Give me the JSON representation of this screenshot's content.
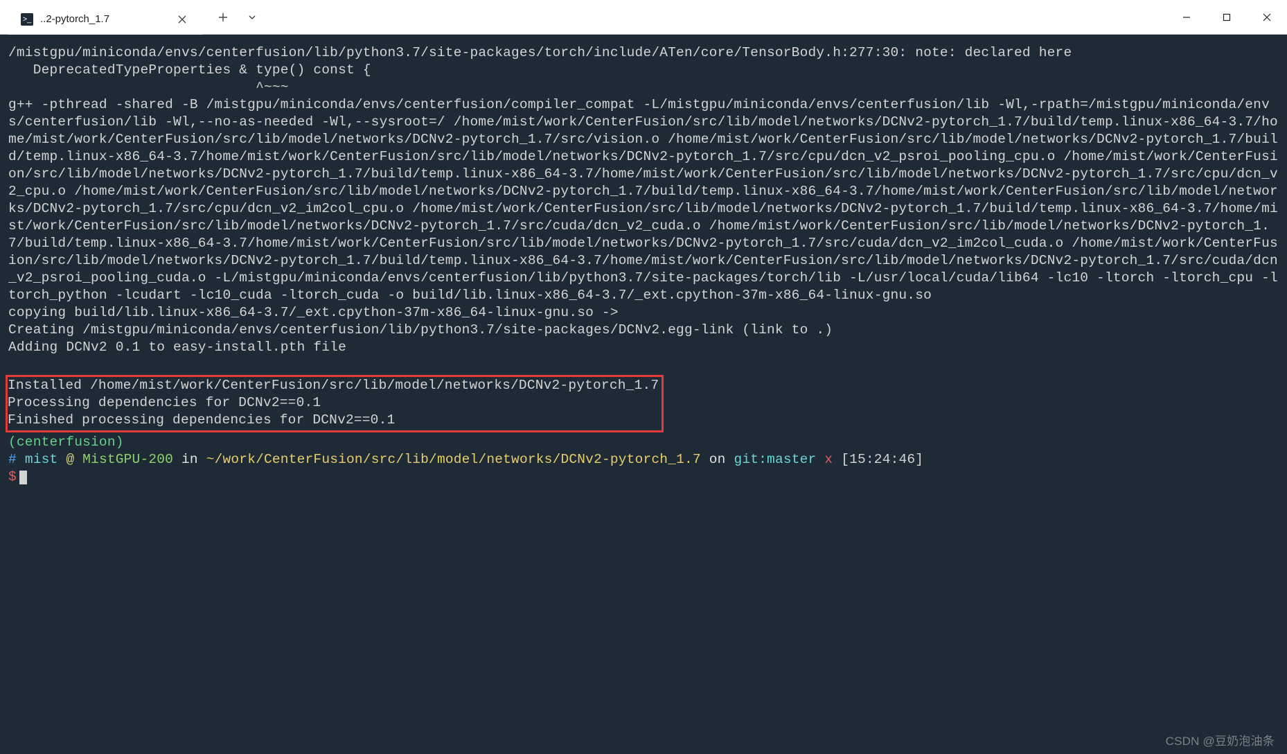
{
  "titlebar": {
    "tab": {
      "icon_glyph": ">_",
      "title": "..2-pytorch_1.7"
    }
  },
  "terminal": {
    "block1": "/mistgpu/miniconda/envs/centerfusion/lib/python3.7/site-packages/torch/include/ATen/core/TensorBody.h:277:30: note: declared here\n   DeprecatedTypeProperties & type() const {\n                              ^~~~",
    "block2": "g++ -pthread -shared -B /mistgpu/miniconda/envs/centerfusion/compiler_compat -L/mistgpu/miniconda/envs/centerfusion/lib -Wl,-rpath=/mistgpu/miniconda/envs/centerfusion/lib -Wl,--no-as-needed -Wl,--sysroot=/ /home/mist/work/CenterFusion/src/lib/model/networks/DCNv2-pytorch_1.7/build/temp.linux-x86_64-3.7/home/mist/work/CenterFusion/src/lib/model/networks/DCNv2-pytorch_1.7/src/vision.o /home/mist/work/CenterFusion/src/lib/model/networks/DCNv2-pytorch_1.7/build/temp.linux-x86_64-3.7/home/mist/work/CenterFusion/src/lib/model/networks/DCNv2-pytorch_1.7/src/cpu/dcn_v2_psroi_pooling_cpu.o /home/mist/work/CenterFusion/src/lib/model/networks/DCNv2-pytorch_1.7/build/temp.linux-x86_64-3.7/home/mist/work/CenterFusion/src/lib/model/networks/DCNv2-pytorch_1.7/src/cpu/dcn_v2_cpu.o /home/mist/work/CenterFusion/src/lib/model/networks/DCNv2-pytorch_1.7/build/temp.linux-x86_64-3.7/home/mist/work/CenterFusion/src/lib/model/networks/DCNv2-pytorch_1.7/src/cpu/dcn_v2_im2col_cpu.o /home/mist/work/CenterFusion/src/lib/model/networks/DCNv2-pytorch_1.7/build/temp.linux-x86_64-3.7/home/mist/work/CenterFusion/src/lib/model/networks/DCNv2-pytorch_1.7/src/cuda/dcn_v2_cuda.o /home/mist/work/CenterFusion/src/lib/model/networks/DCNv2-pytorch_1.7/build/temp.linux-x86_64-3.7/home/mist/work/CenterFusion/src/lib/model/networks/DCNv2-pytorch_1.7/src/cuda/dcn_v2_im2col_cuda.o /home/mist/work/CenterFusion/src/lib/model/networks/DCNv2-pytorch_1.7/build/temp.linux-x86_64-3.7/home/mist/work/CenterFusion/src/lib/model/networks/DCNv2-pytorch_1.7/src/cuda/dcn_v2_psroi_pooling_cuda.o -L/mistgpu/miniconda/envs/centerfusion/lib/python3.7/site-packages/torch/lib -L/usr/local/cuda/lib64 -lc10 -ltorch -ltorch_cpu -ltorch_python -lcudart -lc10_cuda -ltorch_cuda -o build/lib.linux-x86_64-3.7/_ext.cpython-37m-x86_64-linux-gnu.so",
    "block3": "copying build/lib.linux-x86_64-3.7/_ext.cpython-37m-x86_64-linux-gnu.so ->\nCreating /mistgpu/miniconda/envs/centerfusion/lib/python3.7/site-packages/DCNv2.egg-link (link to .)\nAdding DCNv2 0.1 to easy-install.pth file\n",
    "highlighted": "Installed /home/mist/work/CenterFusion/src/lib/model/networks/DCNv2-pytorch_1.7\nProcessing dependencies for DCNv2==0.1\nFinished processing dependencies for DCNv2==0.1",
    "env_line": "(centerfusion)",
    "prompt": {
      "hash": "#",
      "user": "mist",
      "at": "@",
      "host": "MistGPU-200",
      "in_word": "in",
      "path": "~/work/CenterFusion/src/lib/model/networks/DCNv2-pytorch_1.7",
      "on_word": "on",
      "git_word": "git:",
      "branch": "master",
      "x": "x",
      "time": "[15:24:46]",
      "dollar": "$"
    }
  },
  "watermark": "CSDN @豆奶泡油条"
}
